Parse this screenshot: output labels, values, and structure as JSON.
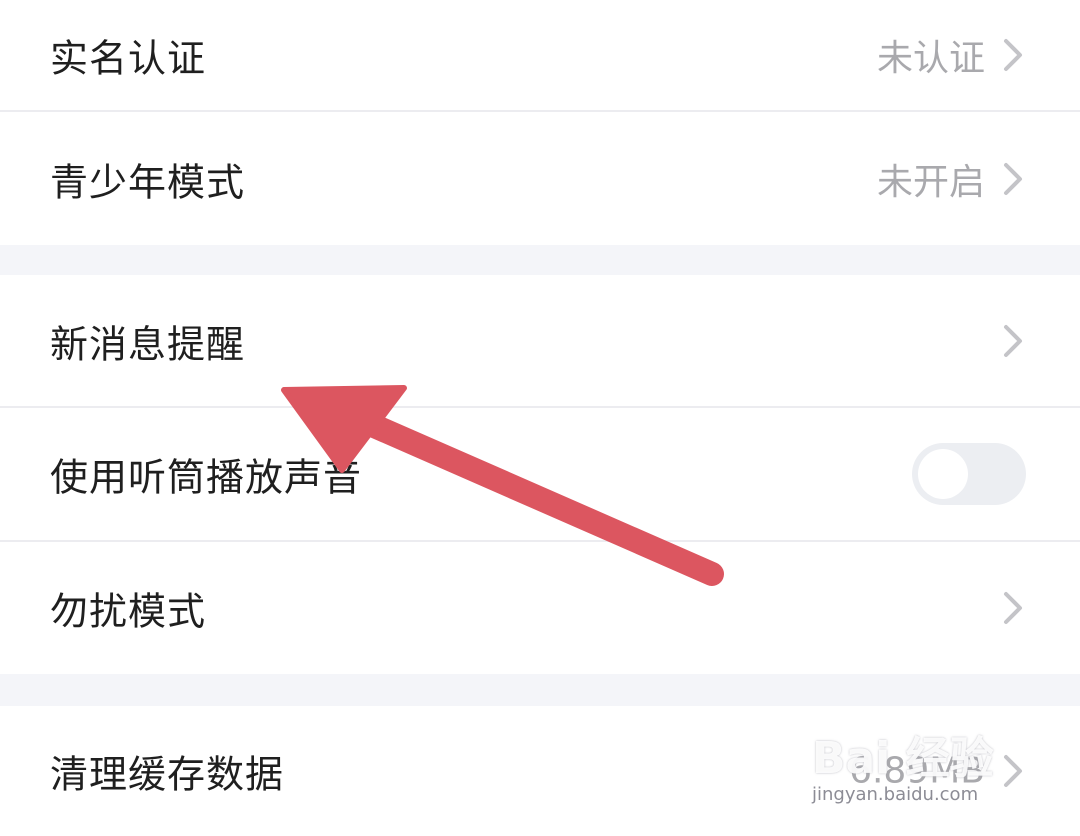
{
  "settings": {
    "group1": [
      {
        "label": "实名认证",
        "value": "未认证"
      },
      {
        "label": "青少年模式",
        "value": "未开启"
      }
    ],
    "group2": [
      {
        "label": "新消息提醒",
        "value": ""
      },
      {
        "label": "使用听筒播放声音",
        "toggle_on": false
      },
      {
        "label": "勿扰模式",
        "value": ""
      }
    ],
    "group3": [
      {
        "label": "清理缓存数据",
        "value": "6.89MB"
      }
    ]
  },
  "colors": {
    "annotation_arrow": "#dc5660",
    "background": "#f4f5f9",
    "row_background": "#ffffff"
  },
  "icons": {
    "chevron": "chevron-right-icon",
    "watermark": "baidu-jingyan-watermark"
  },
  "watermark": {
    "brand": "Bai 经验",
    "url": "jingyan.baidu.com"
  }
}
